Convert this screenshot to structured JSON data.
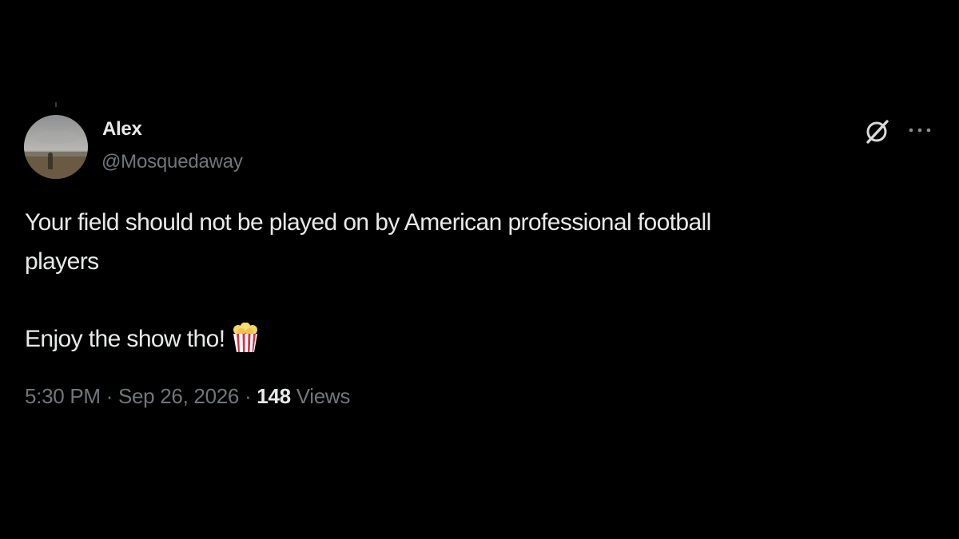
{
  "author": {
    "display_name": "Alex",
    "handle": "@Mosquedaway",
    "avatar_icon": "avatar-photo"
  },
  "actions": {
    "grok_icon": "grok-icon",
    "more_icon": "more-icon"
  },
  "tweet": {
    "line1": "Your field should not be played on by American professional football",
    "line2": "players",
    "line3": "Enjoy the show tho!",
    "emoji_icon": "popcorn-icon"
  },
  "meta": {
    "time": "5:30 PM",
    "separator": "·",
    "date": "Sep 26, 2026",
    "views_count": "148",
    "views_label": "Views"
  },
  "colors": {
    "background": "#000000",
    "primary_text": "#e7e9ea",
    "secondary_text": "#71767b"
  }
}
